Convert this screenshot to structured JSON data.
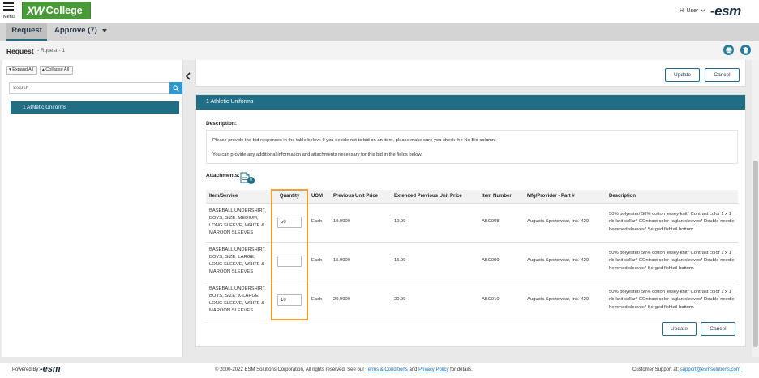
{
  "app": {
    "menu_label": "Menu",
    "logo_mark": "XW",
    "logo_text": "College",
    "greeting": "Hi User",
    "brand": "-esm"
  },
  "nav": {
    "tabs": [
      {
        "label": "Request"
      },
      {
        "label": "Approve (7)"
      }
    ]
  },
  "page": {
    "title": "Request",
    "subtitle": "- Rquest - 1"
  },
  "sidebar": {
    "expand_label": "Expand All",
    "collapse_label": "Collapse All",
    "search_placeholder": "Search",
    "tree_items": [
      {
        "label": "1 Athletic Uniforms"
      }
    ]
  },
  "top_actions": {
    "update_label": "Update",
    "cancel_label": "Cancel"
  },
  "section": {
    "header": "1 Athletic Uniforms",
    "description_label": "Description:",
    "description_lines": [
      "Please provide the bid responses in the table below. If you decide not to bid on an item, please make sure you check the No Bid column.",
      "You can provide any additional information and attachments necessary for this bid in the fields below."
    ],
    "attachments_label": "Attachments:",
    "attachments_count": "0"
  },
  "table": {
    "columns": [
      "Item/Service",
      "Quantity",
      "UOM",
      "Previous Unit Price",
      "Extended Previous Unit Price",
      "Item Number",
      "Mfg/Provider - Part #",
      "Description"
    ],
    "rows": [
      {
        "item": "BASEBALL UNDERSHIRT, BOYS, SIZE: MEDIUM, LONG SLEEVE, WHITE & MAROON SLEEVES",
        "quantity": "50",
        "uom": "Each",
        "prev_price": "19.9900",
        "ext_price": "19.99",
        "item_number": "ABC008",
        "mfg": "Augusta Sportswear, Inc.-420",
        "description": "50% polyester/ 50% cotton jersey knit* Contrast color 1 x 1 rib-knit collar* COntrast color raglan sleeves* Double-needle hemmed sleeves* Serged fishtail bottom."
      },
      {
        "item": "BASEBALL UNDERSHIRT, BOYS, SIZE: LARGE, LONG SLEEVE, WHITE & MAROON SLEEVES",
        "quantity": "",
        "uom": "Each",
        "prev_price": "15.9900",
        "ext_price": "15.99",
        "item_number": "ABC009",
        "mfg": "Augusta Sportswear, Inc.-420",
        "description": "50% polyester/ 50% cotton jersey knit* Contrast color 1 x 1 rib-knit collar* COntrast color raglan sleeves* Double-needle hemmed sleeves* Serged fishtail bottom."
      },
      {
        "item": "BASEBALL UNDERSHIRT, BOYS, SIZE: X-LARGE, LONG SLEEVE, WHITE & MAROON SLEEVES",
        "quantity": "10",
        "uom": "Each",
        "prev_price": "20.9900",
        "ext_price": "20.99",
        "item_number": "ABC010",
        "mfg": "Augusta Sportswear, Inc.-420",
        "description": "50% polyester/ 50% cotton jersey knit* Contrast color 1 x 1 rib-knit collar* COntrast color raglan sleeves* Double-needle hemmed sleeves* Serged fishtail bottom."
      }
    ]
  },
  "bottom_actions": {
    "update_label": "Update",
    "cancel_label": "Cancel"
  },
  "footer": {
    "powered_by": "Powered By:",
    "powered_logo": "-esm",
    "copyright_prefix": "© 2000-2022 ESM Solutions Corporation, All rights reserved. See our",
    "terms_link": "Terms & Conditions",
    "and_text": "and",
    "privacy_link": "Privacy Policy",
    "copyright_suffix": "for details.",
    "support_label": "Customer Support at:",
    "support_email": "support@esmsolutions.com"
  },
  "colors": {
    "brand_teal": "#1f6e86",
    "logo_green": "#4a9a3a",
    "highlight_orange": "#f0a030",
    "search_blue": "#2c9ad1"
  },
  "icons": [
    "menu-icon",
    "chevron-down-icon",
    "print-icon",
    "trash-icon",
    "search-icon",
    "chevron-left-icon",
    "attachment-icon"
  ]
}
